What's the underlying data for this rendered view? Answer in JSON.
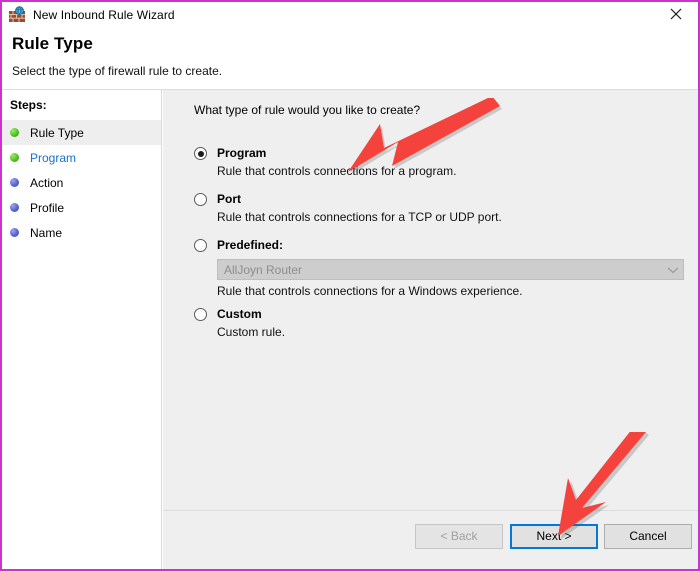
{
  "window": {
    "title": "New Inbound Rule Wizard",
    "icon": "firewall-icon",
    "close_label": "Close",
    "border_color": "#cc33cc"
  },
  "header": {
    "title": "Rule Type",
    "subtitle": "Select the type of firewall rule to create."
  },
  "sidebar": {
    "label": "Steps:",
    "items": [
      {
        "label": "Rule Type",
        "state": "current",
        "bullet": "green"
      },
      {
        "label": "Program",
        "state": "link",
        "bullet": "green"
      },
      {
        "label": "Action",
        "state": "pending",
        "bullet": "blue"
      },
      {
        "label": "Profile",
        "state": "pending",
        "bullet": "blue"
      },
      {
        "label": "Name",
        "state": "pending",
        "bullet": "blue"
      }
    ]
  },
  "main": {
    "question": "What type of rule would you like to create?",
    "options": [
      {
        "label": "Program",
        "description": "Rule that controls connections for a program.",
        "selected": true
      },
      {
        "label": "Port",
        "description": "Rule that controls connections for a TCP or UDP port.",
        "selected": false
      },
      {
        "label": "Predefined:",
        "description": "Rule that controls connections for a Windows experience.",
        "selected": false,
        "combo_value": "AllJoyn Router",
        "combo_disabled": true
      },
      {
        "label": "Custom",
        "description": "Custom rule.",
        "selected": false
      }
    ]
  },
  "footer": {
    "back_label": "< Back",
    "back_disabled": true,
    "next_label": "Next >",
    "next_default": true,
    "cancel_label": "Cancel"
  },
  "annotations": {
    "accent_color": "#f4433c",
    "arrows": [
      {
        "name": "arrow-to-program-option",
        "direction": "down-left"
      },
      {
        "name": "arrow-to-next-button",
        "direction": "down-left"
      }
    ]
  }
}
